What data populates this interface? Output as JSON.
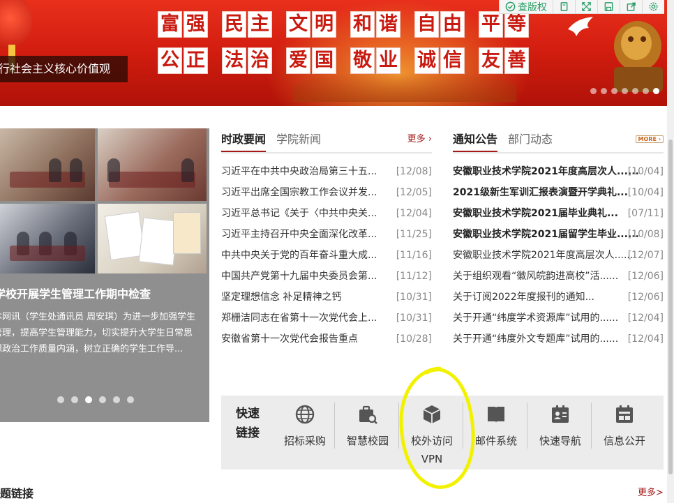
{
  "toolbar": {
    "items": [
      {
        "name": "check-copyright",
        "label": "查版权"
      },
      {
        "name": "copy"
      },
      {
        "name": "fullscreen"
      },
      {
        "name": "save"
      },
      {
        "name": "share"
      },
      {
        "name": "settings"
      }
    ]
  },
  "banner": {
    "slogans_row1": [
      "富强",
      "民主",
      "文明",
      "和谐",
      "自由",
      "平等"
    ],
    "slogans_row2": [
      "公正",
      "法治",
      "爱国",
      "敬业",
      "诚信",
      "友善"
    ],
    "motto": "践行社会主义核心价值观",
    "slide_count": 7,
    "active_slide": 6,
    "accent": "#d41e10"
  },
  "photo_news": {
    "title": "学校开展学生管理工作期中检查",
    "summary_lines": [
      "本网讯（学生处通讯员 周安琪）为进一步加强学生",
      "管理，提高学生管理能力，切实提升大学生日常思",
      "想政治工作质量内涵，树立正确的学生工作导..."
    ],
    "dot_count": 6,
    "active_dot": 2
  },
  "news_col1": {
    "tabs": [
      "时政要闻",
      "学院新闻"
    ],
    "more": "更多 ›",
    "items": [
      {
        "title": "习近平在中共中央政治局第三十五...",
        "date": "[12/08]"
      },
      {
        "title": "习近平出席全国宗教工作会议并发...",
        "date": "[12/05]"
      },
      {
        "title": "习近平总书记《关于〈中共中央关...",
        "date": "[12/04]"
      },
      {
        "title": "习近平主持召开中央全面深化改革...",
        "date": "[11/25]"
      },
      {
        "title": "中共中央关于党的百年奋斗重大成...",
        "date": "[11/16]"
      },
      {
        "title": "中国共产党第十九届中央委员会第...",
        "date": "[11/12]"
      },
      {
        "title": "坚定理想信念 补足精神之钙",
        "date": "[10/31]"
      },
      {
        "title": "郑栅洁同志在省第十一次党代会上...",
        "date": "[10/31]"
      },
      {
        "title": "安徽省第十一次党代会报告重点",
        "date": "[10/28]"
      }
    ]
  },
  "news_col2": {
    "tabs": [
      "通知公告",
      "部门动态"
    ],
    "more": "MORE ›",
    "items": [
      {
        "title": "安徽职业技术学院2021年度高层次人......",
        "date": "[10/04]",
        "bold": true
      },
      {
        "title": "2021级新生军训汇报表演暨开学典礼...",
        "date": "[10/04]",
        "bold": true
      },
      {
        "title": "安徽职业技术学院2021届毕业典礼...",
        "date": "[07/11]",
        "bold": true
      },
      {
        "title": "安徽职业技术学院2021届留学生毕业......",
        "date": "[10/08]",
        "bold": true
      },
      {
        "title": "安徽职业技术学院2021年度高层次人......",
        "date": "[12/07]",
        "bold": false
      },
      {
        "title": "关于组织观看“徽风皖韵进高校”活......",
        "date": "[12/06]",
        "bold": false
      },
      {
        "title": "关于订阅2022年度报刊的通知...",
        "date": "[12/06]",
        "bold": false
      },
      {
        "title": "关于开通“纬度学术资源库”试用的......",
        "date": "[12/04]",
        "bold": false
      },
      {
        "title": "关于开通“纬度外文专题库”试用的......",
        "date": "[12/04]",
        "bold": false
      }
    ]
  },
  "quick_links": {
    "title_lines": [
      "快速",
      "链接"
    ],
    "items": [
      {
        "id": "bidding",
        "icon": "globe-icon",
        "label_lines": [
          "招标采购"
        ]
      },
      {
        "id": "smart-campus",
        "icon": "briefcase-search-icon",
        "label_lines": [
          "智慧校园"
        ]
      },
      {
        "id": "vpn",
        "icon": "cube-icon",
        "label_lines": [
          "校外访问",
          "VPN"
        ]
      },
      {
        "id": "mail",
        "icon": "book-icon",
        "label_lines": [
          "邮件系统"
        ]
      },
      {
        "id": "navigation",
        "icon": "contact-card-icon",
        "label_lines": [
          "快速导航"
        ]
      },
      {
        "id": "info-public",
        "icon": "calendar-card-icon",
        "label_lines": [
          "信息公开"
        ]
      }
    ],
    "annotation_color": "#f2f200"
  },
  "bottom": {
    "title": "题链接",
    "more": "更多>"
  }
}
